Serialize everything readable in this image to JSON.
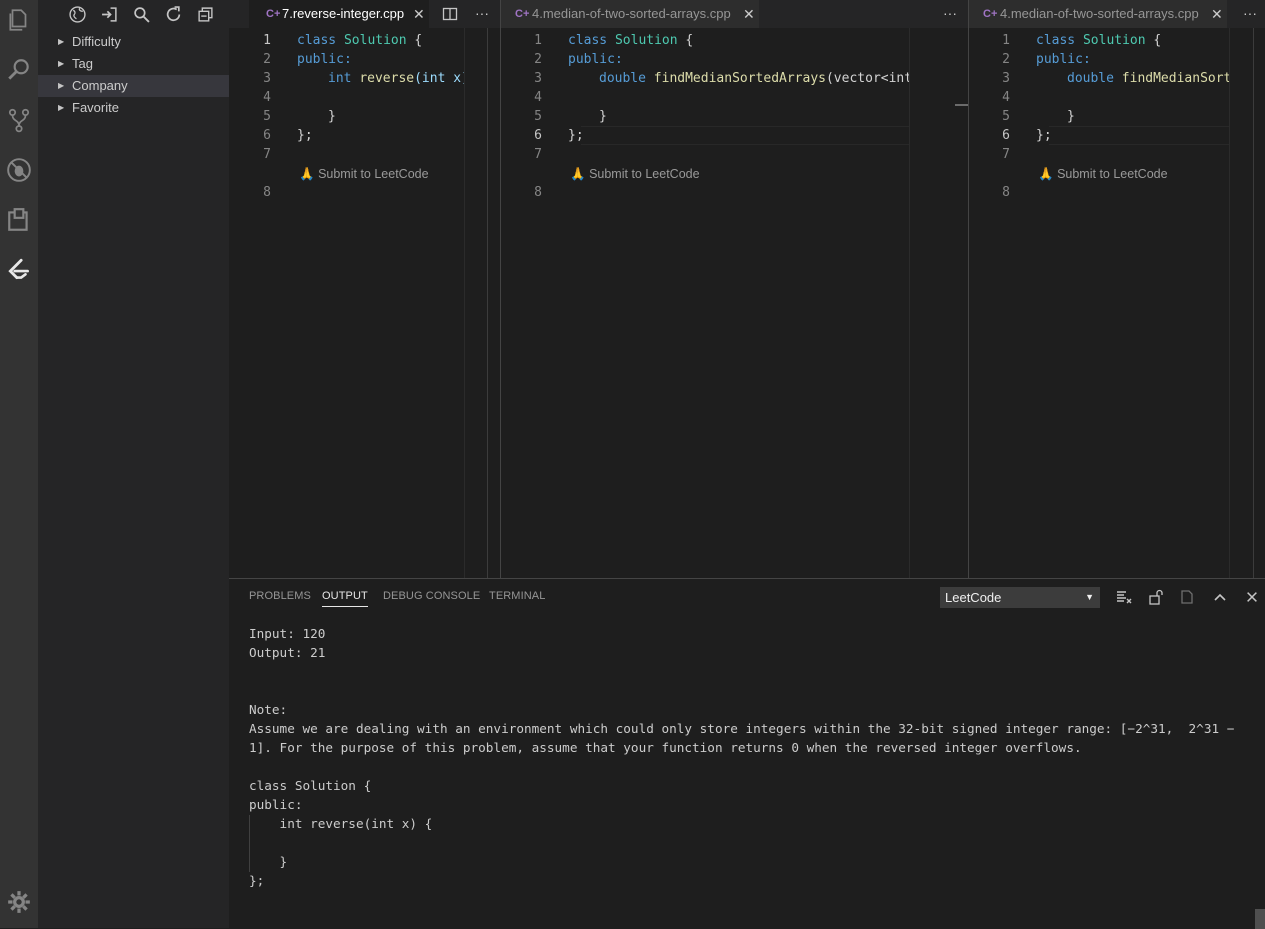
{
  "activity_bar": {
    "icons": [
      "explorer-icon",
      "search-icon",
      "source-control-icon",
      "debug-icon",
      "extensions-icon",
      "leetcode-icon"
    ],
    "bottom_icon": "gear-icon"
  },
  "sidebar": {
    "toolbar_icons": [
      "globe-icon",
      "sign-in-icon",
      "search-icon",
      "refresh-icon",
      "collapse-all-icon"
    ],
    "items": [
      {
        "label": "Difficulty"
      },
      {
        "label": "Tag"
      },
      {
        "label": "Company"
      },
      {
        "label": "Favorite"
      }
    ]
  },
  "groups": [
    {
      "tab": "7.reverse-integer.cpp",
      "lines": {
        "n1": "1",
        "n2": "2",
        "n3": "3",
        "n4": "4",
        "n5": "5",
        "n6": "6",
        "n7": "7",
        "n8": "8"
      },
      "code": {
        "public": "public:",
        "method_type": "int",
        "method_name": "reverse",
        "params": "(int x)"
      },
      "lens": "Submit to LeetCode"
    },
    {
      "tab": "4.median-of-two-sorted-arrays.cpp",
      "lines": {
        "n1": "1",
        "n2": "2",
        "n3": "3",
        "n4": "4",
        "n5": "5",
        "n6": "6",
        "n7": "7",
        "n8": "8"
      },
      "code": {
        "public": "public:",
        "method_type": "double",
        "method_name": "findMedianSortedArrays",
        "params": "(vector<int>"
      },
      "lens": "Submit to LeetCode"
    },
    {
      "tab": "4.median-of-two-sorted-arrays.cpp",
      "lines": {
        "n1": "1",
        "n2": "2",
        "n3": "3",
        "n4": "4",
        "n5": "5",
        "n6": "6",
        "n7": "7",
        "n8": "8"
      },
      "code": {
        "public": "public:",
        "method_type": "double",
        "method_name": "findMedianSortedArrays",
        "params": ""
      },
      "lens": "Submit to LeetCode"
    }
  ],
  "code_common": {
    "class_kw": "class",
    "class_name": "Solution",
    "open_brace": " {",
    "close_brace": "}",
    "end": "};"
  },
  "panel": {
    "tabs": [
      "PROBLEMS",
      "OUTPUT",
      "DEBUG CONSOLE",
      "TERMINAL"
    ],
    "active_tab": "OUTPUT",
    "channel": "LeetCode",
    "output_lines": [
      "Input: 120",
      "Output: 21",
      "",
      "",
      "Note:",
      "Assume we are dealing with an environment which could only store integers within the 32-bit signed integer range: [−2^31,  2^31 −",
      "1]. For the purpose of this problem, assume that your function returns 0 when the reversed integer overflows.",
      "",
      "class Solution {",
      "public:",
      "    int reverse(int x) {",
      "",
      "    }",
      "};"
    ]
  },
  "colors": {
    "activity_bar": "#333333",
    "sidebar": "#252526",
    "editor": "#1e1e1e",
    "keyword": "#569cd6",
    "type": "#4ec9b0",
    "function": "#dcdcaa"
  }
}
